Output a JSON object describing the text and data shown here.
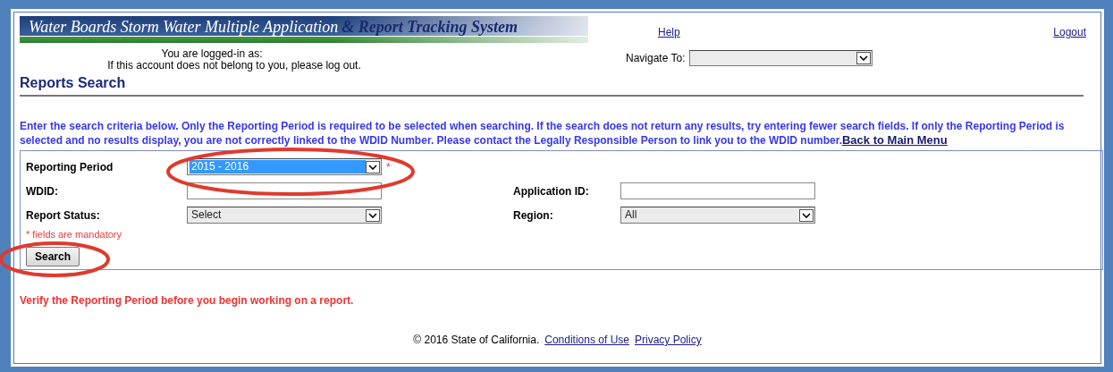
{
  "header": {
    "banner_title": "Water Boards  Storm Water Multiple Application",
    "banner_title_2": "& Report Tracking System",
    "help_link": "Help",
    "logout_link": "Logout",
    "logged_in": "You are logged-in as:",
    "account_note": "If this account does not belong to you, please log out.",
    "navigate_label": "Navigate To:"
  },
  "page_title": "Reports Search",
  "instructions": "Enter the search criteria below. Only the Reporting Period is required to be selected when searching. If the search does not return any results, try entering fewer search fields. If only the Reporting Period is selected and no results display, you are not correctly linked to the WDID Number. Please contact the Legally Responsible Person to link you to the WDID number.",
  "back_link": "Back to Main Menu",
  "fields": [
    {
      "label": "Reporting Period",
      "kind": "select",
      "value": "2015 - 2016",
      "selected": true,
      "required": true
    },
    {
      "label": "WDID:",
      "kind": "input"
    },
    {
      "label": "Application ID:",
      "kind": "input"
    },
    {
      "label": "Report Status:",
      "kind": "select",
      "value": "Select",
      "selected": false
    },
    {
      "label": "Region:",
      "kind": "select",
      "value": "All",
      "selected": false
    }
  ],
  "required_mark": "*",
  "mandatory_note": "* fields are mandatory",
  "search_button": "Search",
  "warning": "Verify the Reporting Period before you begin working on a report.",
  "footer": {
    "copyright": "© 2016 State of California.",
    "links": [
      "Conditions of Use",
      "Privacy Policy"
    ]
  }
}
